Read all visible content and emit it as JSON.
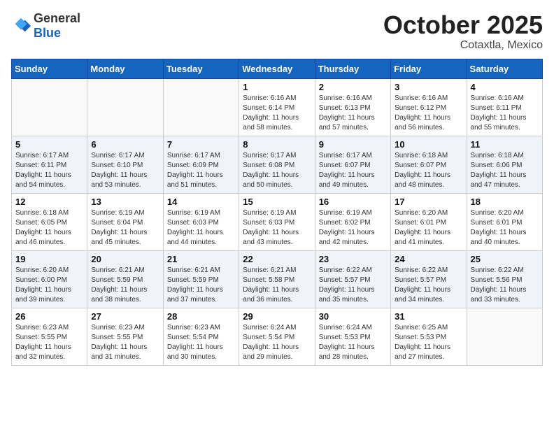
{
  "header": {
    "logo_general": "General",
    "logo_blue": "Blue",
    "month": "October 2025",
    "location": "Cotaxtla, Mexico"
  },
  "weekdays": [
    "Sunday",
    "Monday",
    "Tuesday",
    "Wednesday",
    "Thursday",
    "Friday",
    "Saturday"
  ],
  "weeks": [
    [
      {
        "day": "",
        "info": ""
      },
      {
        "day": "",
        "info": ""
      },
      {
        "day": "",
        "info": ""
      },
      {
        "day": "1",
        "info": "Sunrise: 6:16 AM\nSunset: 6:14 PM\nDaylight: 11 hours\nand 58 minutes."
      },
      {
        "day": "2",
        "info": "Sunrise: 6:16 AM\nSunset: 6:13 PM\nDaylight: 11 hours\nand 57 minutes."
      },
      {
        "day": "3",
        "info": "Sunrise: 6:16 AM\nSunset: 6:12 PM\nDaylight: 11 hours\nand 56 minutes."
      },
      {
        "day": "4",
        "info": "Sunrise: 6:16 AM\nSunset: 6:11 PM\nDaylight: 11 hours\nand 55 minutes."
      }
    ],
    [
      {
        "day": "5",
        "info": "Sunrise: 6:17 AM\nSunset: 6:11 PM\nDaylight: 11 hours\nand 54 minutes."
      },
      {
        "day": "6",
        "info": "Sunrise: 6:17 AM\nSunset: 6:10 PM\nDaylight: 11 hours\nand 53 minutes."
      },
      {
        "day": "7",
        "info": "Sunrise: 6:17 AM\nSunset: 6:09 PM\nDaylight: 11 hours\nand 51 minutes."
      },
      {
        "day": "8",
        "info": "Sunrise: 6:17 AM\nSunset: 6:08 PM\nDaylight: 11 hours\nand 50 minutes."
      },
      {
        "day": "9",
        "info": "Sunrise: 6:17 AM\nSunset: 6:07 PM\nDaylight: 11 hours\nand 49 minutes."
      },
      {
        "day": "10",
        "info": "Sunrise: 6:18 AM\nSunset: 6:07 PM\nDaylight: 11 hours\nand 48 minutes."
      },
      {
        "day": "11",
        "info": "Sunrise: 6:18 AM\nSunset: 6:06 PM\nDaylight: 11 hours\nand 47 minutes."
      }
    ],
    [
      {
        "day": "12",
        "info": "Sunrise: 6:18 AM\nSunset: 6:05 PM\nDaylight: 11 hours\nand 46 minutes."
      },
      {
        "day": "13",
        "info": "Sunrise: 6:19 AM\nSunset: 6:04 PM\nDaylight: 11 hours\nand 45 minutes."
      },
      {
        "day": "14",
        "info": "Sunrise: 6:19 AM\nSunset: 6:03 PM\nDaylight: 11 hours\nand 44 minutes."
      },
      {
        "day": "15",
        "info": "Sunrise: 6:19 AM\nSunset: 6:03 PM\nDaylight: 11 hours\nand 43 minutes."
      },
      {
        "day": "16",
        "info": "Sunrise: 6:19 AM\nSunset: 6:02 PM\nDaylight: 11 hours\nand 42 minutes."
      },
      {
        "day": "17",
        "info": "Sunrise: 6:20 AM\nSunset: 6:01 PM\nDaylight: 11 hours\nand 41 minutes."
      },
      {
        "day": "18",
        "info": "Sunrise: 6:20 AM\nSunset: 6:01 PM\nDaylight: 11 hours\nand 40 minutes."
      }
    ],
    [
      {
        "day": "19",
        "info": "Sunrise: 6:20 AM\nSunset: 6:00 PM\nDaylight: 11 hours\nand 39 minutes."
      },
      {
        "day": "20",
        "info": "Sunrise: 6:21 AM\nSunset: 5:59 PM\nDaylight: 11 hours\nand 38 minutes."
      },
      {
        "day": "21",
        "info": "Sunrise: 6:21 AM\nSunset: 5:59 PM\nDaylight: 11 hours\nand 37 minutes."
      },
      {
        "day": "22",
        "info": "Sunrise: 6:21 AM\nSunset: 5:58 PM\nDaylight: 11 hours\nand 36 minutes."
      },
      {
        "day": "23",
        "info": "Sunrise: 6:22 AM\nSunset: 5:57 PM\nDaylight: 11 hours\nand 35 minutes."
      },
      {
        "day": "24",
        "info": "Sunrise: 6:22 AM\nSunset: 5:57 PM\nDaylight: 11 hours\nand 34 minutes."
      },
      {
        "day": "25",
        "info": "Sunrise: 6:22 AM\nSunset: 5:56 PM\nDaylight: 11 hours\nand 33 minutes."
      }
    ],
    [
      {
        "day": "26",
        "info": "Sunrise: 6:23 AM\nSunset: 5:55 PM\nDaylight: 11 hours\nand 32 minutes."
      },
      {
        "day": "27",
        "info": "Sunrise: 6:23 AM\nSunset: 5:55 PM\nDaylight: 11 hours\nand 31 minutes."
      },
      {
        "day": "28",
        "info": "Sunrise: 6:23 AM\nSunset: 5:54 PM\nDaylight: 11 hours\nand 30 minutes."
      },
      {
        "day": "29",
        "info": "Sunrise: 6:24 AM\nSunset: 5:54 PM\nDaylight: 11 hours\nand 29 minutes."
      },
      {
        "day": "30",
        "info": "Sunrise: 6:24 AM\nSunset: 5:53 PM\nDaylight: 11 hours\nand 28 minutes."
      },
      {
        "day": "31",
        "info": "Sunrise: 6:25 AM\nSunset: 5:53 PM\nDaylight: 11 hours\nand 27 minutes."
      },
      {
        "day": "",
        "info": ""
      }
    ]
  ]
}
